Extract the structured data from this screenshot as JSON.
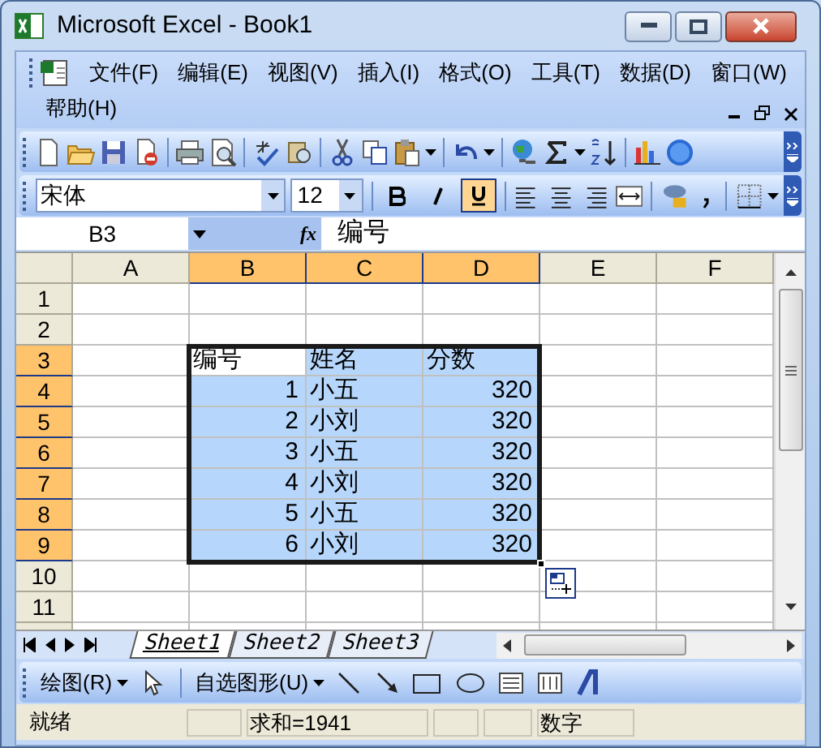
{
  "window": {
    "title": "Microsoft Excel - Book1"
  },
  "menu": [
    {
      "label": "文件(F)"
    },
    {
      "label": "编辑(E)"
    },
    {
      "label": "视图(V)"
    },
    {
      "label": "插入(I)"
    },
    {
      "label": "格式(O)"
    },
    {
      "label": "工具(T)"
    },
    {
      "label": "数据(D)"
    },
    {
      "label": "窗口(W)"
    },
    {
      "label": "帮助(H)"
    }
  ],
  "format_toolbar": {
    "font": "宋体",
    "size": "12",
    "bold": false,
    "italic": false,
    "underline": true
  },
  "formula_bar": {
    "name_box": "B3",
    "fx": "fx",
    "value": "编号"
  },
  "columns": [
    {
      "label": "A",
      "selected": false
    },
    {
      "label": "B",
      "selected": true
    },
    {
      "label": "C",
      "selected": true
    },
    {
      "label": "D",
      "selected": true
    },
    {
      "label": "E",
      "selected": false
    },
    {
      "label": "F",
      "selected": false
    }
  ],
  "rows": [
    {
      "label": "1",
      "selected": false
    },
    {
      "label": "2",
      "selected": false
    },
    {
      "label": "3",
      "selected": true,
      "cells": [
        {
          "text": "编号",
          "kind": "text",
          "active": true
        },
        {
          "text": "姓名",
          "kind": "text",
          "active": false
        },
        {
          "text": "分数",
          "kind": "text",
          "active": false
        }
      ]
    },
    {
      "label": "4",
      "selected": true,
      "cells": [
        {
          "text": "1",
          "kind": "number",
          "active": false
        },
        {
          "text": "小五",
          "kind": "text",
          "active": false
        },
        {
          "text": "320",
          "kind": "number",
          "active": false
        }
      ]
    },
    {
      "label": "5",
      "selected": true,
      "cells": [
        {
          "text": "2",
          "kind": "number",
          "active": false
        },
        {
          "text": "小刘",
          "kind": "text",
          "active": false
        },
        {
          "text": "320",
          "kind": "number",
          "active": false
        }
      ]
    },
    {
      "label": "6",
      "selected": true,
      "cells": [
        {
          "text": "3",
          "kind": "number",
          "active": false
        },
        {
          "text": "小五",
          "kind": "text",
          "active": false
        },
        {
          "text": "320",
          "kind": "number",
          "active": false
        }
      ]
    },
    {
      "label": "7",
      "selected": true,
      "cells": [
        {
          "text": "4",
          "kind": "number",
          "active": false
        },
        {
          "text": "小刘",
          "kind": "text",
          "active": false
        },
        {
          "text": "320",
          "kind": "number",
          "active": false
        }
      ]
    },
    {
      "label": "8",
      "selected": true,
      "cells": [
        {
          "text": "5",
          "kind": "number",
          "active": false
        },
        {
          "text": "小五",
          "kind": "text",
          "active": false
        },
        {
          "text": "320",
          "kind": "number",
          "active": false
        }
      ]
    },
    {
      "label": "9",
      "selected": true,
      "cells": [
        {
          "text": "6",
          "kind": "number",
          "active": false
        },
        {
          "text": "小刘",
          "kind": "text",
          "active": false
        },
        {
          "text": "320",
          "kind": "number",
          "active": false
        }
      ]
    },
    {
      "label": "10",
      "selected": false
    },
    {
      "label": "11",
      "selected": false
    }
  ],
  "sheet_tabs": [
    {
      "label": "Sheet1",
      "selected": true
    },
    {
      "label": "Sheet2",
      "selected": false
    },
    {
      "label": "Sheet3",
      "selected": false
    }
  ],
  "drawing_toolbar": {
    "draw_menu": "绘图(R)",
    "autoshapes_menu": "自选图形(U)"
  },
  "status_bar": {
    "state": "就绪",
    "sum": "求和=1941",
    "mode": "数字"
  }
}
